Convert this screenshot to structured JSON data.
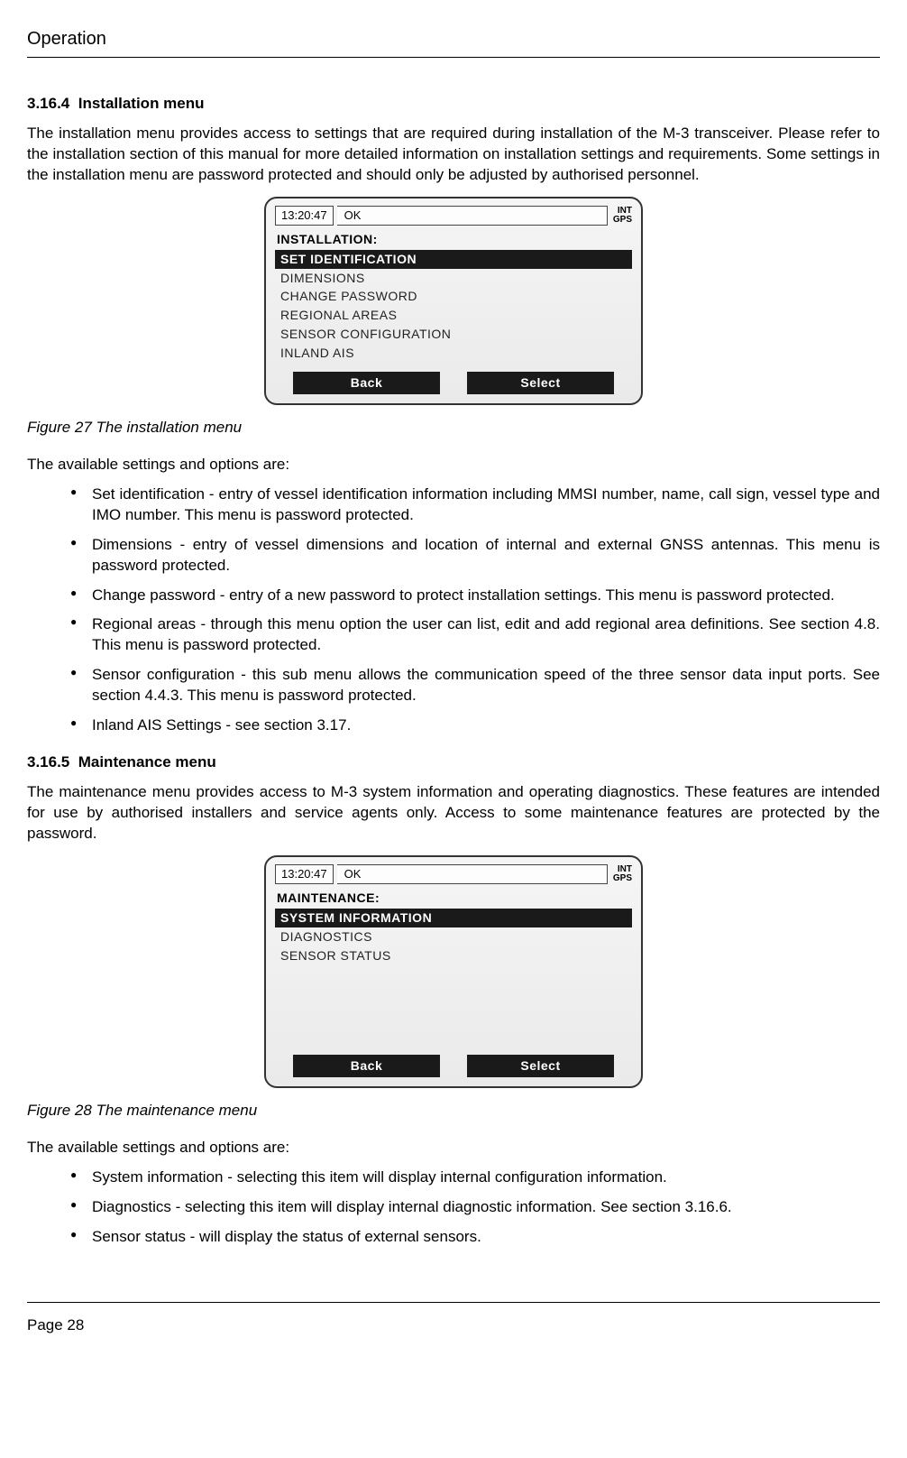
{
  "header": "Operation",
  "section1": {
    "number": "3.16.4",
    "title": "Installation menu",
    "para": "The installation menu provides access to settings that are required during installation of the M-3 transceiver. Please refer to the installation section of this manual for more detailed information on installation settings and requirements. Some settings in the installation menu are password protected and should only be adjusted by authorised personnel."
  },
  "fig27": {
    "time": "13:20:47",
    "status": "OK",
    "gps1": "INT",
    "gps2": "GPS",
    "menu_title": "INSTALLATION:",
    "items": [
      "SET IDENTIFICATION",
      "DIMENSIONS",
      "CHANGE PASSWORD",
      "REGIONAL AREAS",
      "SENSOR CONFIGURATION",
      "INLAND AIS"
    ],
    "back": "Back",
    "select": "Select",
    "caption": "Figure 27   The installation menu"
  },
  "options1_intro": "The available settings and options are:",
  "options1": [
    "Set identification - entry of vessel identification information including MMSI number, name, call sign, vessel type and IMO number. This menu is password protected.",
    "Dimensions - entry of vessel dimensions and location of internal and external GNSS antennas. This menu is password protected.",
    "Change password - entry of a new password to protect installation settings. This menu is password protected.",
    "Regional areas - through this menu option the user can list, edit and add regional area definitions. See section 4.8. This menu is password protected.",
    "Sensor configuration - this sub menu allows the communication speed of the three sensor data input ports. See section 4.4.3. This menu is password protected.",
    "Inland AIS Settings - see section 3.17."
  ],
  "section2": {
    "number": "3.16.5",
    "title": "Maintenance menu",
    "para": "The maintenance menu provides access to M-3 system information and operating diagnostics. These features are intended for use by authorised installers and service agents only. Access to some maintenance features are protected by the password."
  },
  "fig28": {
    "time": "13:20:47",
    "status": "OK",
    "gps1": "INT",
    "gps2": "GPS",
    "menu_title": "MAINTENANCE:",
    "items": [
      "SYSTEM INFORMATION",
      "DIAGNOSTICS",
      "SENSOR STATUS"
    ],
    "back": "Back",
    "select": "Select",
    "caption": "Figure 28   The maintenance menu"
  },
  "options2_intro": "The available settings and options are:",
  "options2": [
    "System information - selecting this item will display internal configuration information.",
    "Diagnostics - selecting this item will display internal diagnostic information. See section 3.16.6.",
    "Sensor status - will display the status of external sensors."
  ],
  "page_num": "Page 28"
}
